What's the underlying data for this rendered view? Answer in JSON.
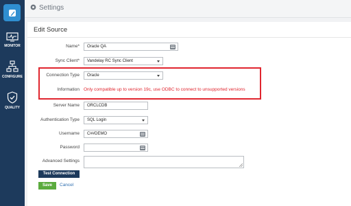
{
  "sidebar": {
    "items": [
      {
        "label": "MONITOR",
        "icon": "monitor-icon"
      },
      {
        "label": "CONFIGURE",
        "icon": "configure-icon"
      },
      {
        "label": "QUALITY",
        "icon": "quality-icon"
      }
    ]
  },
  "header": {
    "title": "Settings",
    "icon": "gear-icon"
  },
  "form": {
    "title": "Edit Source",
    "name": {
      "label": "Name*",
      "value": "Oracle QA"
    },
    "sync_client": {
      "label": "Sync Client*",
      "value": "Vandelay RC Sync Client"
    },
    "connection_type": {
      "label": "Connection Type",
      "value": "Oracle"
    },
    "information": {
      "label": "Information",
      "value": "Only compatible up to version 19c, use ODBC to connect to unsupported versions"
    },
    "server_name": {
      "label": "Server Name",
      "value": "ORCLCDB"
    },
    "auth_type": {
      "label": "Authentication Type",
      "value": "SQL Login"
    },
    "username": {
      "label": "Username",
      "value": "C##DEMO"
    },
    "password": {
      "label": "Password",
      "value": ""
    },
    "advanced": {
      "label": "Advanced Settings",
      "value": ""
    }
  },
  "buttons": {
    "test_connection": "Test Connection",
    "save": "Save",
    "cancel": "Cancel"
  },
  "colors": {
    "sidebar": "#1d3a5c",
    "accent": "#2f8ed0",
    "warning": "#e0252e",
    "save": "#5bab3e"
  }
}
